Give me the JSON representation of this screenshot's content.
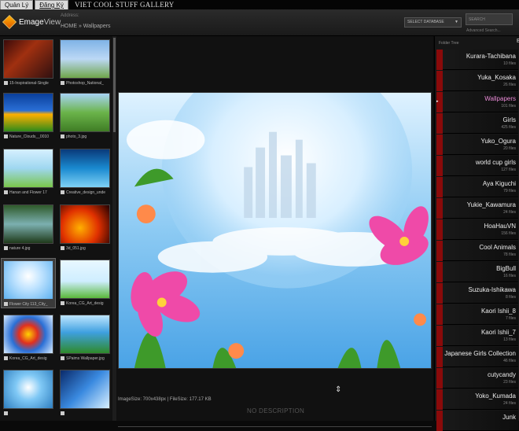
{
  "topbar": {
    "tab_manage": "Quản Lý",
    "tab_register": "Đăng Ký",
    "title": "VIET COOL STUFF GALLERY"
  },
  "header": {
    "logo_main": "Emage",
    "logo_sub": "View",
    "address_label": "Address:",
    "breadcrumb": "HOME » Wallpapers",
    "select_db": "SELECT DATABASE",
    "search_placeholder": "SEARCH",
    "advanced_search": "Advanced Search..."
  },
  "thumbnails": [
    {
      "caption": "15-Inspirational-Single"
    },
    {
      "caption": "Photoshop_National_"
    },
    {
      "caption": "Nature_Clouds__0010"
    },
    {
      "caption": "photo_3.jpg"
    },
    {
      "caption": "Hanan and Flower 17"
    },
    {
      "caption": "Creative_design_unde"
    },
    {
      "caption": "nature 4.jpg"
    },
    {
      "caption": "3d_051.jpg"
    },
    {
      "caption": "Flower City 113_City_"
    },
    {
      "caption": "Korea_CG_Art_desig"
    },
    {
      "caption": "Korea_CG_Art_desig"
    },
    {
      "caption": "SPaims Wallpaper.jpg"
    },
    {
      "caption": ""
    },
    {
      "caption": ""
    }
  ],
  "viewer": {
    "image_info": "ImageSize: 700x438px | FileSize: 177.17 KB",
    "no_description": "NO DESCRIPTION"
  },
  "sidebar": {
    "label": "Folder Tree",
    "marker": "E",
    "folders": [
      {
        "name": "Kurara-Tachibana",
        "count": "10 files"
      },
      {
        "name": "Yuka_Kosaka",
        "count": "26 files"
      },
      {
        "name": "Wallpapers",
        "count": "101 files"
      },
      {
        "name": "Girls",
        "count": "425 files"
      },
      {
        "name": "Yuko_Ogura",
        "count": "20 files"
      },
      {
        "name": "world cup girls",
        "count": "127 files"
      },
      {
        "name": "Aya Kiguchi",
        "count": "79 files"
      },
      {
        "name": "Yukie_Kawamura",
        "count": "24 files"
      },
      {
        "name": "HoaHauVN",
        "count": "156 files"
      },
      {
        "name": "Cool Animals",
        "count": "78 files"
      },
      {
        "name": "BigBull",
        "count": "16 files"
      },
      {
        "name": "Suzuka-Ishikawa",
        "count": "8 files"
      },
      {
        "name": "Kaori Ishii_8",
        "count": "7 files"
      },
      {
        "name": "Kaori Ishii_7",
        "count": "13 files"
      },
      {
        "name": "Japanese Girls Collection",
        "count": "46 files"
      },
      {
        "name": "cutycandy",
        "count": "23 files"
      },
      {
        "name": "Yoko_Kumada",
        "count": "24 files"
      },
      {
        "name": "Junk",
        "count": ""
      }
    ]
  },
  "colors": {
    "accent_pink": "#e98ad6",
    "folder_bar": "#8a0a0a"
  }
}
